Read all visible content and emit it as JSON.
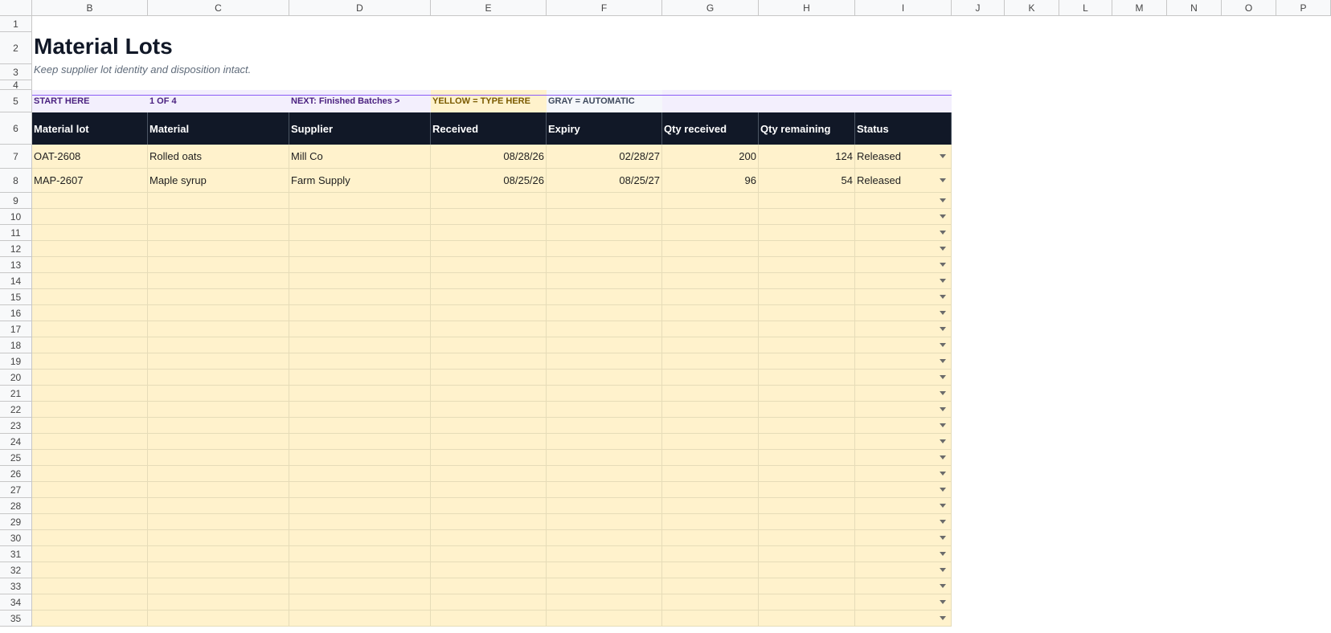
{
  "columns": [
    "B",
    "C",
    "D",
    "E",
    "F",
    "G",
    "H",
    "I",
    "J",
    "K",
    "L",
    "M",
    "N",
    "O",
    "P"
  ],
  "rows": [
    "1",
    "2",
    "3",
    "4",
    "5",
    "6",
    "7",
    "8",
    "9",
    "10",
    "11",
    "12",
    "13",
    "14",
    "15",
    "16",
    "17",
    "18",
    "19",
    "20",
    "21",
    "22",
    "23",
    "24",
    "25",
    "26",
    "27",
    "28",
    "29",
    "30",
    "31",
    "32",
    "33",
    "34",
    "35"
  ],
  "sheet": {
    "title": "Material Lots",
    "subtitle": "Keep supplier lot identity and disposition intact."
  },
  "banner": {
    "start": "START HERE",
    "step": "1 OF 4",
    "next": "NEXT: Finished Batches  >",
    "yellow_legend": "YELLOW = TYPE HERE",
    "gray_legend": "GRAY = AUTOMATIC"
  },
  "table": {
    "headers": [
      "Material lot",
      "Material",
      "Supplier",
      "Received",
      "Expiry",
      "Qty received",
      "Qty remaining",
      "Status"
    ],
    "records": [
      [
        "OAT-2608",
        "Rolled oats",
        "Mill Co",
        "08/28/26",
        "02/28/27",
        "200",
        "124",
        "Released"
      ],
      [
        "MAP-2607",
        "Maple syrup",
        "Farm Supply",
        "08/25/26",
        "08/25/27",
        "96",
        "54",
        "Released"
      ]
    ]
  },
  "colors": {
    "header_bg": "#111827",
    "input_yellow": "#fff2cc",
    "banner_purple": "#f3effd",
    "accent_violet": "#8b5cf6"
  }
}
